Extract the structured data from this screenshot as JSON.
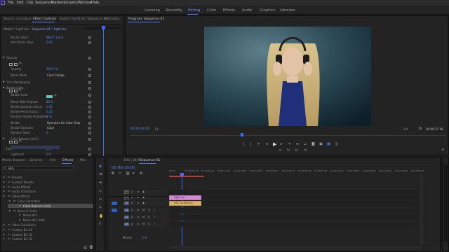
{
  "menubar": {
    "items": [
      "File",
      "Edit",
      "Clip",
      "Sequence",
      "Markers",
      "Graphic",
      "Window",
      "Help"
    ]
  },
  "workspaces": [
    "Learning",
    "Assembly",
    "Editing",
    "Color",
    "Effects",
    "Audio",
    "Graphics",
    "Libraries"
  ],
  "active_workspace": "Editing",
  "source_panel": {
    "tabs": [
      "Source: (no clips)",
      "Effect Controls",
      "Audio Clip Mixer: Sequence 01",
      "Metadata"
    ],
    "active_tab": "Effect Controls",
    "master": "Master * Light lea...",
    "clip": "Sequence 01 * Light lea",
    "props": [
      {
        "label": "Anchor Point",
        "value": "960.0   540.0"
      },
      {
        "label": "Anti-flicker Filter",
        "value": "0.00"
      },
      {
        "label": "Opacity",
        "value": ""
      },
      {
        "label": "Opacity",
        "value": "100.0 %"
      },
      {
        "label": "Blend Mode",
        "value": "Color Dodge"
      },
      {
        "label": "Time Remapping",
        "value": ""
      },
      {
        "label": "Strobe Light",
        "value": ""
      },
      {
        "label": "Strobe Color",
        "value": ""
      },
      {
        "label": "Blend With Original",
        "value": "80 %"
      },
      {
        "label": "Strobe Duration (secs)",
        "value": "0.05"
      },
      {
        "label": "Strobe Period (secs)",
        "value": "0.20"
      },
      {
        "label": "Random Strobe Probability",
        "value": "0 %"
      },
      {
        "label": "Strobe",
        "value": "Operates On Color Only"
      },
      {
        "label": "Strobe Operator",
        "value": "Copy"
      },
      {
        "label": "Random Seed",
        "value": "0"
      },
      {
        "label": "Color Balance (HLS)",
        "value": ""
      },
      {
        "label": "Hue",
        "value": "0.0 °"
      },
      {
        "label": "Lightness",
        "value": "0.0"
      },
      {
        "label": "Saturation",
        "value": "0.0"
      }
    ],
    "timecode": "00:00:10:00",
    "strobe_color_hex": "#5ec6b4"
  },
  "program": {
    "title": "Program: Sequence 01",
    "timecode": "00:00:10:00",
    "fit": "Fit",
    "quality": "1/4",
    "duration": "00:00:27:18"
  },
  "effects_panel": {
    "tabs": [
      "Media Browser",
      "Libraries",
      "Info",
      "Effects",
      "Mar"
    ],
    "active_tab": "Effects",
    "search": "HLS",
    "tree": [
      {
        "label": "Presets",
        "indent": 0
      },
      {
        "label": "Lumetri Presets",
        "indent": 0
      },
      {
        "label": "Audio Effects",
        "indent": 0
      },
      {
        "label": "Audio Transitions",
        "indent": 0
      },
      {
        "label": "Video Effects",
        "indent": 0
      },
      {
        "label": "Color Correction",
        "indent": 1
      },
      {
        "label": "Color Balance (HLS)",
        "indent": 2,
        "selected": true
      },
      {
        "label": "Noise & Grain",
        "indent": 1
      },
      {
        "label": "Noise HLS",
        "indent": 2
      },
      {
        "label": "Noise HLS Auto",
        "indent": 2
      },
      {
        "label": "Video Transitions",
        "indent": 0
      },
      {
        "label": "Custom Bin 01",
        "indent": 0
      },
      {
        "label": "Custom Bin 02",
        "indent": 0
      },
      {
        "label": "Custom Bin 03",
        "indent": 0
      }
    ]
  },
  "timeline": {
    "tabs": [
      "DSC_0449",
      "Sequence 01"
    ],
    "active_tab": "Sequence 01",
    "timecode": "00:00:10:00",
    "ruler": [
      "00:00",
      "00:00:04:23",
      "00:00:09:23",
      "00:00:14:23",
      "00:00:19:23",
      "00:00:24:23",
      "00:00:29:23",
      "00:00:34:23",
      "00:00:39:22",
      "00:00:44:22",
      "00:00:49:22",
      "00:00:54:22",
      "00:00:59:22",
      "00:01:04:22",
      "00:01:09:22",
      "00:01:14:22"
    ],
    "video_tracks": [
      "V3",
      "V2",
      "V1"
    ],
    "audio_tracks": [
      "A1",
      "A2",
      "A3"
    ],
    "master": "Master",
    "master_val": "0.0",
    "clip_pink": "Light lea",
    "clip_gold": "DSC_0449.mov"
  }
}
